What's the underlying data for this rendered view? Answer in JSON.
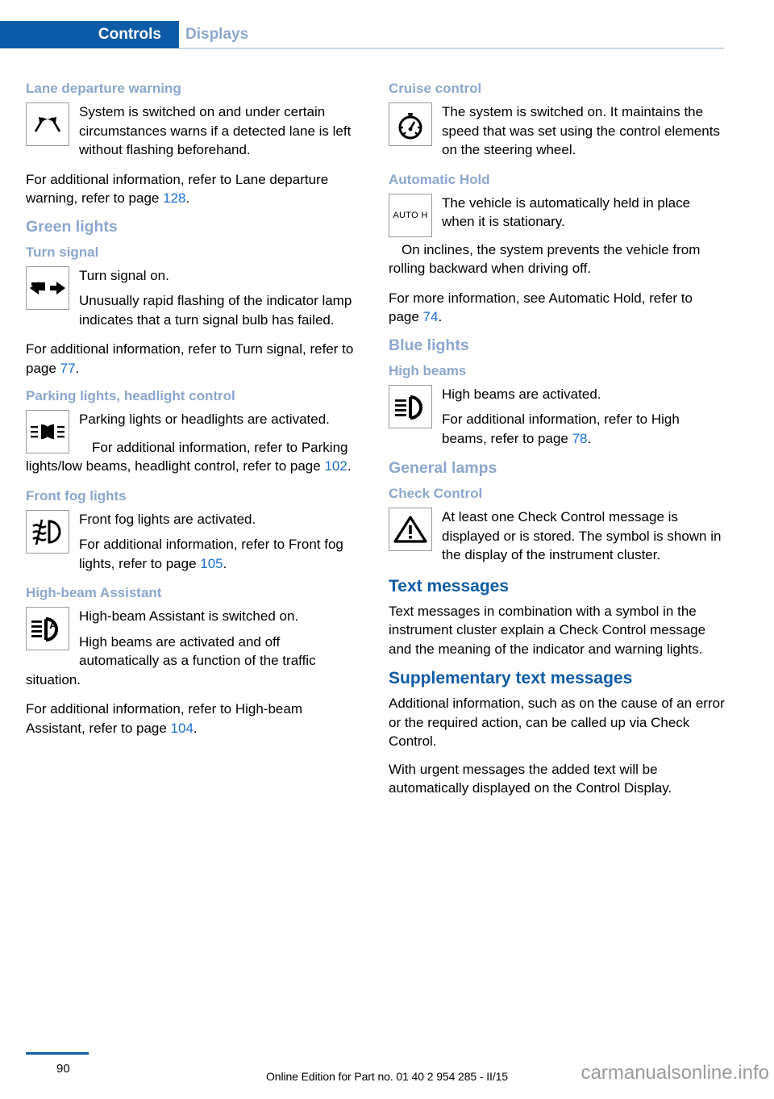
{
  "header": {
    "tab_active": "Controls",
    "tab_inactive": "Displays",
    "accent_blue": "#0d5ba6",
    "muted_blue": "#8ba7cf",
    "link_blue": "#1b6fd4"
  },
  "left_column": {
    "lane_departure": {
      "heading": "Lane departure warning",
      "icon": "lane-departure-warning-icon",
      "body1": "System is switched on and under certain circumstances warns if a detected lane is left without flashing beforehand.",
      "body2_pre": "For additional information, refer to Lane departure warning, refer to page ",
      "body2_page": "128",
      "body2_post": "."
    },
    "green_lights": {
      "heading": "Green lights"
    },
    "turn_signal": {
      "heading": "Turn signal",
      "icon": "turn-signal-icon",
      "body1": "Turn signal on.",
      "body2": "Unusually rapid flashing of the indicator lamp indicates that a turn signal bulb has failed.",
      "body3_pre": "For additional information, refer to Turn signal, refer to page ",
      "body3_page": "77",
      "body3_post": "."
    },
    "parking_lights": {
      "heading": "Parking lights, headlight control",
      "icon": "parking-lights-icon",
      "body1": "Parking lights or headlights are activated.",
      "body2_pre": "For additional information, refer to Parking lights/low beams, headlight control, refer to page ",
      "body2_page": "102",
      "body2_post": "."
    },
    "front_fog_lights": {
      "heading": "Front fog lights",
      "icon": "front-fog-lights-icon",
      "body1": "Front fog lights are activated.",
      "body2_pre": "For additional information, refer to Front fog lights, refer to page ",
      "body2_page": "105",
      "body2_post": "."
    },
    "high_beam_assistant": {
      "heading": "High-beam Assistant",
      "icon": "high-beam-assistant-icon",
      "body1": "High-beam Assistant is switched on.",
      "body2": "High beams are activated and off automatically as a function of the traffic situation.",
      "body3_pre": "For additional information, refer to High-beam Assistant, refer to page ",
      "body3_page": "104",
      "body3_post": "."
    }
  },
  "right_column": {
    "cruise_control": {
      "heading": "Cruise control",
      "icon": "cruise-control-icon",
      "body1": "The system is switched on. It maintains the speed that was set using the control elements on the steering wheel."
    },
    "automatic_hold": {
      "heading": "Automatic Hold",
      "icon": "automatic-hold-icon",
      "icon_label": "AUTO H",
      "body1": "The vehicle is automatically held in place when it is stationary.",
      "body2": "On inclines, the system prevents the vehicle from rolling backward when driving off.",
      "body3_pre": "For more information, see Automatic Hold, refer to page ",
      "body3_page": "74",
      "body3_post": "."
    },
    "blue_lights": {
      "heading": "Blue lights"
    },
    "high_beams": {
      "heading": "High beams",
      "icon": "high-beams-icon",
      "body1": "High beams are activated.",
      "body2_pre": "For additional information, refer to High beams, refer to page ",
      "body2_page": "78",
      "body2_post": "."
    },
    "general_lamps": {
      "heading": "General lamps"
    },
    "check_control": {
      "heading": "Check Control",
      "icon": "warning-triangle-icon",
      "body1": "At least one Check Control message is displayed or is stored. The symbol is shown in the display of the instrument cluster."
    },
    "text_messages": {
      "heading": "Text messages",
      "body1": "Text messages in combination with a symbol in the instrument cluster explain a Check Control message and the meaning of the indicator and warning lights."
    },
    "supplementary_text_messages": {
      "heading": "Supplementary text messages",
      "body1": "Additional information, such as on the cause of an error or the required action, can be called up via Check Control.",
      "body2": "With urgent messages the added text will be automatically displayed on the Control Display."
    }
  },
  "footer": {
    "page_number": "90",
    "edition": "Online Edition for Part no. 01 40 2 954 285 - II/15",
    "watermark": "carmanualsonline.info"
  }
}
